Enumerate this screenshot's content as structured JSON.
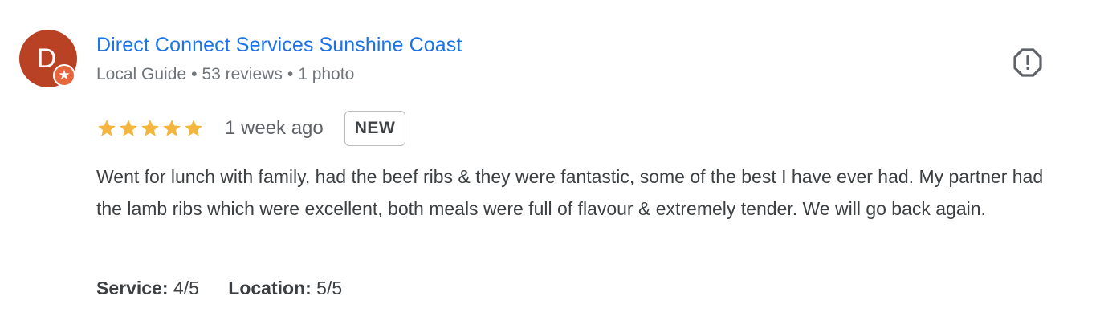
{
  "reviewer": {
    "avatar_letter": "D",
    "name": "Direct Connect Services Sunshine Coast",
    "guide_label": "Local Guide",
    "separator": "•",
    "reviews_count": "53 reviews",
    "photos_count": "1 photo"
  },
  "rating": {
    "stars": 5,
    "max_stars": 5,
    "date": "1 week ago",
    "badge": "NEW"
  },
  "review_text": "Went for lunch with family, had the beef ribs & they were fantastic, some of the best I have ever had. My partner had the lamb ribs which were excellent, both meals were full of flavour & extremely tender. We will go back again.",
  "attributes": [
    {
      "label": "Service:",
      "value": "4/5"
    },
    {
      "label": "Location:",
      "value": "5/5"
    }
  ],
  "icons": {
    "report": "report-icon",
    "star": "star-icon",
    "guide_badge": "local-guide-star-icon"
  },
  "colors": {
    "avatar_bg": "#b84223",
    "badge_bg": "#e8663d",
    "name_link": "#1a73e8",
    "star_fill": "#f4b63f"
  }
}
